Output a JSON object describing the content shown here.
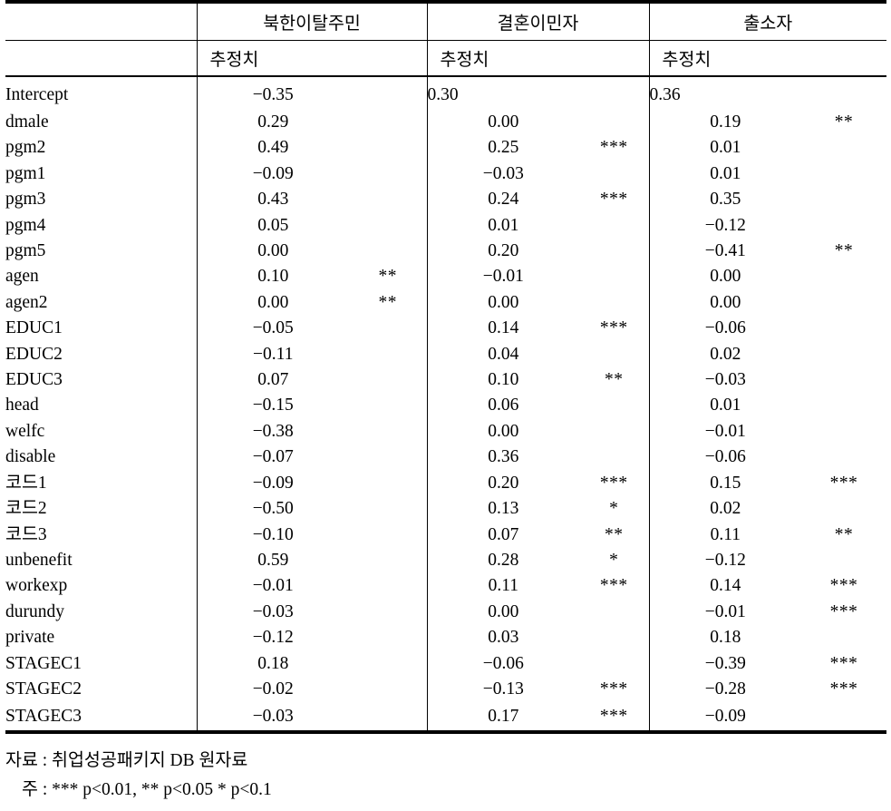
{
  "table": {
    "row_header_label": "",
    "group_headers": [
      {
        "label": "북한이탈주민"
      },
      {
        "label": "결혼이민자"
      },
      {
        "label": "출소자"
      }
    ],
    "sub_headers": [
      "추정치",
      "추정치",
      "추정치"
    ],
    "rows": [
      {
        "variable": "Intercept",
        "a_val": "−0.35",
        "a_sig": "",
        "b_val": "0.30",
        "b_sig": "",
        "c_val": "0.36",
        "c_sig": ""
      },
      {
        "variable": "dmale",
        "a_val": "0.29",
        "a_sig": "",
        "b_val": "0.00",
        "b_sig": "",
        "c_val": "0.19",
        "c_sig": "**"
      },
      {
        "variable": "pgm2",
        "a_val": "0.49",
        "a_sig": "",
        "b_val": "0.25",
        "b_sig": "***",
        "c_val": "0.01",
        "c_sig": ""
      },
      {
        "variable": "pgm1",
        "a_val": "−0.09",
        "a_sig": "",
        "b_val": "−0.03",
        "b_sig": "",
        "c_val": "0.01",
        "c_sig": ""
      },
      {
        "variable": "pgm3",
        "a_val": "0.43",
        "a_sig": "",
        "b_val": "0.24",
        "b_sig": "***",
        "c_val": "0.35",
        "c_sig": ""
      },
      {
        "variable": "pgm4",
        "a_val": "0.05",
        "a_sig": "",
        "b_val": "0.01",
        "b_sig": "",
        "c_val": "−0.12",
        "c_sig": ""
      },
      {
        "variable": "pgm5",
        "a_val": "0.00",
        "a_sig": "",
        "b_val": "0.20",
        "b_sig": "",
        "c_val": "−0.41",
        "c_sig": "**"
      },
      {
        "variable": "agen",
        "a_val": "0.10",
        "a_sig": "**",
        "b_val": "−0.01",
        "b_sig": "",
        "c_val": "0.00",
        "c_sig": ""
      },
      {
        "variable": "agen2",
        "a_val": "0.00",
        "a_sig": "**",
        "b_val": "0.00",
        "b_sig": "",
        "c_val": "0.00",
        "c_sig": ""
      },
      {
        "variable": "EDUC1",
        "a_val": "−0.05",
        "a_sig": "",
        "b_val": "0.14",
        "b_sig": "***",
        "c_val": "−0.06",
        "c_sig": ""
      },
      {
        "variable": "EDUC2",
        "a_val": "−0.11",
        "a_sig": "",
        "b_val": "0.04",
        "b_sig": "",
        "c_val": "0.02",
        "c_sig": ""
      },
      {
        "variable": "EDUC3",
        "a_val": "0.07",
        "a_sig": "",
        "b_val": "0.10",
        "b_sig": "**",
        "c_val": "−0.03",
        "c_sig": ""
      },
      {
        "variable": "head",
        "a_val": "−0.15",
        "a_sig": "",
        "b_val": "0.06",
        "b_sig": "",
        "c_val": "0.01",
        "c_sig": ""
      },
      {
        "variable": "welfc",
        "a_val": "−0.38",
        "a_sig": "",
        "b_val": "0.00",
        "b_sig": "",
        "c_val": "−0.01",
        "c_sig": ""
      },
      {
        "variable": "disable",
        "a_val": "−0.07",
        "a_sig": "",
        "b_val": "0.36",
        "b_sig": "",
        "c_val": "−0.06",
        "c_sig": ""
      },
      {
        "variable": "코드1",
        "a_val": "−0.09",
        "a_sig": "",
        "b_val": "0.20",
        "b_sig": "***",
        "c_val": "0.15",
        "c_sig": "***"
      },
      {
        "variable": "코드2",
        "a_val": "−0.50",
        "a_sig": "",
        "b_val": "0.13",
        "b_sig": "*",
        "c_val": "0.02",
        "c_sig": ""
      },
      {
        "variable": "코드3",
        "a_val": "−0.10",
        "a_sig": "",
        "b_val": "0.07",
        "b_sig": "**",
        "c_val": "0.11",
        "c_sig": "**"
      },
      {
        "variable": "unbenefit",
        "a_val": "0.59",
        "a_sig": "",
        "b_val": "0.28",
        "b_sig": "*",
        "c_val": "−0.12",
        "c_sig": ""
      },
      {
        "variable": "workexp",
        "a_val": "−0.01",
        "a_sig": "",
        "b_val": "0.11",
        "b_sig": "***",
        "c_val": "0.14",
        "c_sig": "***"
      },
      {
        "variable": "durundy",
        "a_val": "−0.03",
        "a_sig": "",
        "b_val": "0.00",
        "b_sig": "",
        "c_val": "−0.01",
        "c_sig": "***"
      },
      {
        "variable": "private",
        "a_val": "−0.12",
        "a_sig": "",
        "b_val": "0.03",
        "b_sig": "",
        "c_val": "0.18",
        "c_sig": ""
      },
      {
        "variable": "STAGEC1",
        "a_val": "0.18",
        "a_sig": "",
        "b_val": "−0.06",
        "b_sig": "",
        "c_val": "−0.39",
        "c_sig": "***"
      },
      {
        "variable": "STAGEC2",
        "a_val": "−0.02",
        "a_sig": "",
        "b_val": "−0.13",
        "b_sig": "***",
        "c_val": "−0.28",
        "c_sig": "***"
      },
      {
        "variable": "STAGEC3",
        "a_val": "−0.03",
        "a_sig": "",
        "b_val": "0.17",
        "b_sig": "***",
        "c_val": "−0.09",
        "c_sig": ""
      }
    ]
  },
  "notes": {
    "source": "자료 : 취업성공패키지 DB 원자료",
    "significance": "주 : *** p<0.01, ** p<0.05 * p<0.1"
  }
}
